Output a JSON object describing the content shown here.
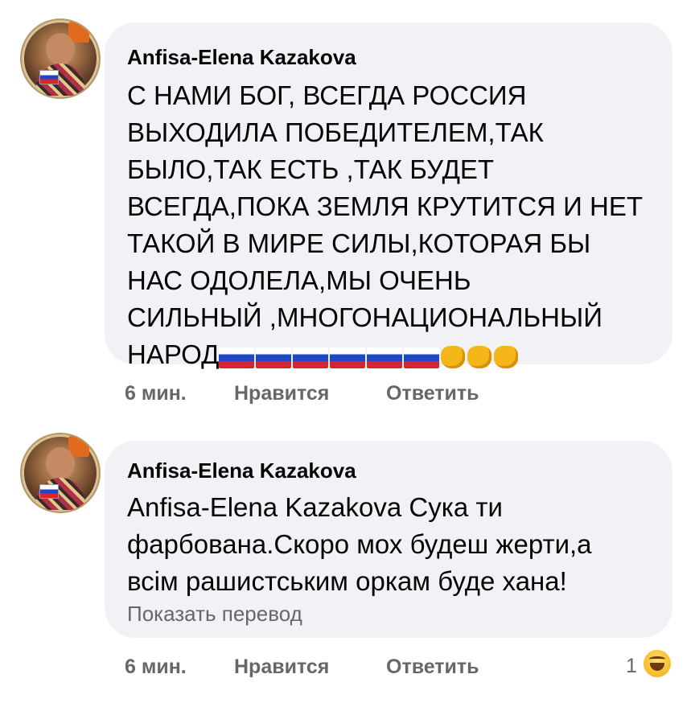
{
  "comments": [
    {
      "author": "Anfisa-Elena Kazakova",
      "text": "С НАМИ БОГ, ВСЕГДА РОССИЯ\nВЫХОДИЛА ПОБЕДИТЕЛЕМ,ТАК\nБЫЛО,ТАК ЕСТЬ ,ТАК БУДЕТ\nВСЕГДА,ПОКА ЗЕМЛЯ КРУТИТСЯ И НЕТ\nТАКОЙ В МИРЕ СИЛЫ,КОТОРАЯ БЫ\nНАС ОДОЛЕЛА,МЫ ОЧЕНЬ\nСИЛЬНЫЙ ,МНОГОНАЦИОНАЛЬНЫЙ\nНАРОД",
      "emoji_names": [
        "russia-flag-icon",
        "russia-flag-icon",
        "russia-flag-icon",
        "russia-flag-icon",
        "russia-flag-icon",
        "russia-flag-icon",
        "fist-icon",
        "fist-icon",
        "fist-icon"
      ],
      "time": "6 мин.",
      "like_label": "Нравится",
      "reply_label": "Ответить"
    },
    {
      "author": "Anfisa-Elena Kazakova",
      "text": "Anfisa-Elena Kazakova Сука ти\nфарбована.Скоро мох будеш жерти,а\nвсім рашистським оркам буде хана!",
      "translate_label": "Показать перевод",
      "time": "6 мин.",
      "like_label": "Нравится",
      "reply_label": "Ответить",
      "reaction_count": "1",
      "reaction_icon": "laugh-emoji-icon"
    }
  ],
  "colors": {
    "bubble": "#f0f2f5",
    "text": "#050505",
    "secondary_text": "#65676b"
  }
}
